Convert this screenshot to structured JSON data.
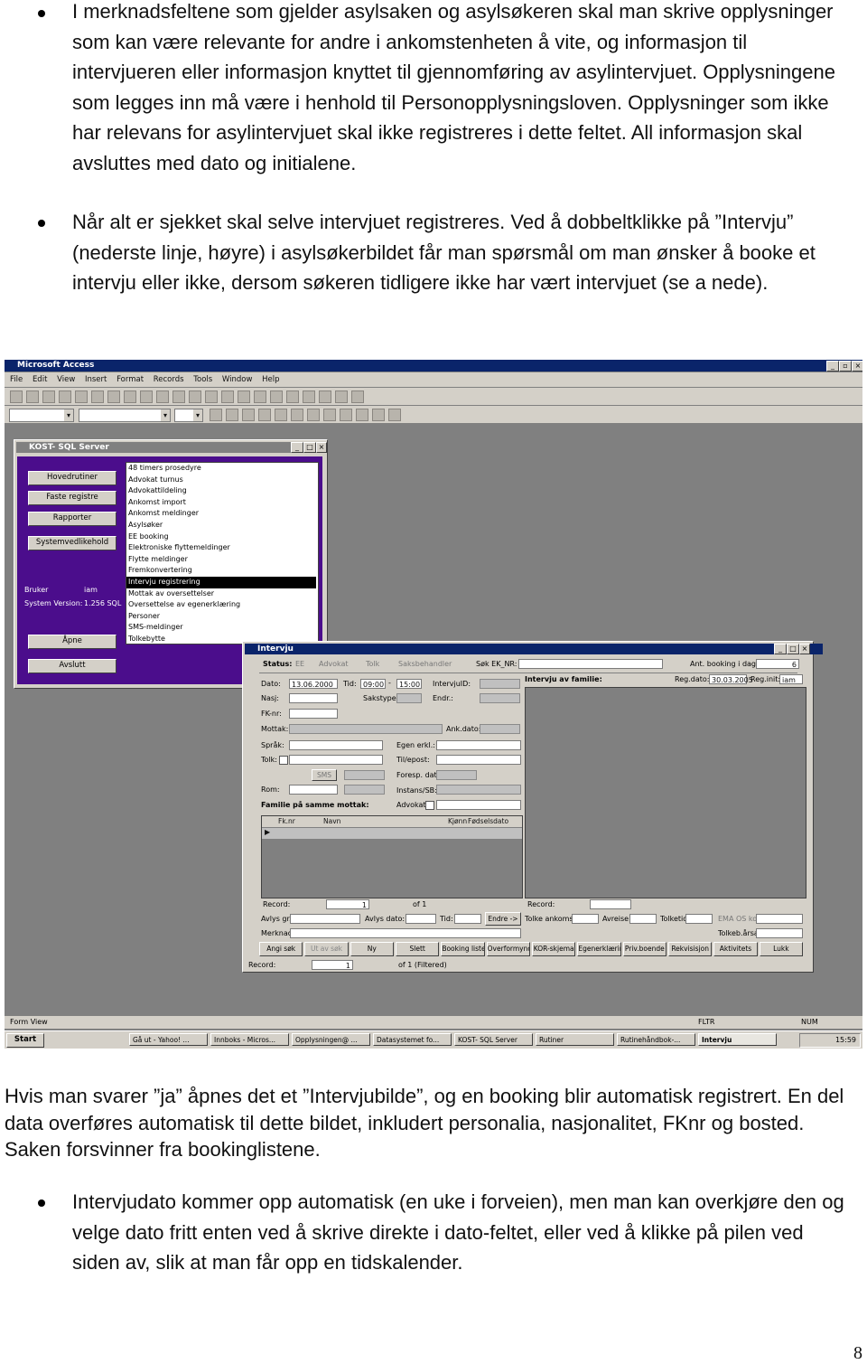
{
  "intro": {
    "bullet1": "I merknadsfeltene som gjelder asylsaken og asylsøkeren skal man skrive opplysninger som kan være relevante for andre i ankomstenheten å vite, og informasjon til intervjueren eller informasjon knyttet til gjennomføring av asylintervjuet. Opplysningene som legges inn må være i henhold til Personopplysningsloven. Opplysninger som ikke har relevans for asylintervjuet skal ikke registreres i dette feltet. All informasjon skal avsluttes med dato og initialene.",
    "bullet2": "Når alt er sjekket skal selve intervjuet registreres. Ved å dobbeltklikke på ”Intervju” (nederste linje, høyre) i asylsøkerbildet får man spørsmål om man ønsker å booke et intervju eller ikke, dersom søkeren tidligere ikke har vært intervjuet (se a nede)."
  },
  "screenshot": {
    "app_title": "Microsoft Access",
    "menu": [
      "File",
      "Edit",
      "View",
      "Insert",
      "Format",
      "Records",
      "Tools",
      "Window",
      "Help"
    ],
    "kost_title": "KOST- SQL Server",
    "kost_buttons": [
      "Hovedrutiner",
      "Faste registre",
      "Rapporter",
      "Systemvedlikehold"
    ],
    "bruker_label": "Bruker",
    "bruker_value": "iam",
    "version_label": "System Version:",
    "version_value": "1.256 SQL",
    "apne": "Åpne",
    "avslutt": "Avslutt",
    "list_items": [
      "48 timers prosedyre",
      "Advokat turnus",
      "Advokattildeling",
      "Ankomst import",
      "Ankomst meldinger",
      "Asylsøker",
      "EE booking",
      "Elektroniske flyttemeldinger",
      "Flytte meldinger",
      "Fremkonvertering",
      "Intervju registrering",
      "Mottak av oversettelser",
      "Oversettelse av egenerklæring",
      "Personer",
      "SMS-meldinger",
      "Tolkebytte"
    ],
    "intervju_title": "Intervju",
    "status_label": "Status:",
    "opt_ee": "EE",
    "opt_advokat": "Advokat",
    "opt_tolk": "Tolk",
    "opt_saksbehandler": "Saksbehandler",
    "sok_label": "Søk EK_NR:",
    "dato_label": "Dato:",
    "dato_value": "13.06.2000",
    "tid_label": "Tid:",
    "tid_value": "09:00",
    "tid_end": "15:00",
    "intervjuid_label": "IntervjuID:",
    "nasj_label": "Nasj:",
    "sakstype_label": "Sakstype:",
    "endr_label": "Endr.:",
    "fknr_label": "FK-nr:",
    "mottak_label": "Mottak:",
    "ank_label": "Ank.dato:",
    "sprak_label": "Språk:",
    "egen_label": "Egen erkl.:",
    "tolk_label": "Tolk:",
    "tilepost_label": "Til/epost:",
    "sms_label": "SMS",
    "foresp_label": "Foresp. dato",
    "rom_label": "Rom:",
    "instans_label": "Instans/SB:",
    "familie_label": "Familie på samme mottak:",
    "advokat_label": "Advokat:",
    "fam_headers": [
      "Fk.nr",
      "Navn",
      "Kjønn",
      "Fødselsdato"
    ],
    "record_label": "Record:",
    "record_value": "1",
    "of_label": "of 1",
    "avlys_label": "Avlys gr.:",
    "avlys_dato_label": "Avlys dato:",
    "tid2_label": "Tid:",
    "endre_label": "Endre ->",
    "merknad_label": "Merknad:",
    "intervju_av_familie": "Intervju av familie:",
    "ant_booking_label": "Ant. booking i dag:",
    "ant_booking_value": "6",
    "reg_dato_label": "Reg.dato:",
    "reg_dato_value": "30.03.2005",
    "reg_init_label": "Reg.init:",
    "reg_init_value": "iam",
    "record2_label": "Record:",
    "tolke_ankomst": "Tolke ankomst:",
    "avreise": "Avreise:",
    "tolkettid": "Tolketid:",
    "ema_label": "EMA OS kode",
    "tolkeb_label": "Tolkeb.årsak:",
    "bottom_buttons": [
      "Angi søk",
      "Ut av søk",
      "Ny",
      "Slett",
      "Booking liste",
      "Overformynd",
      "KOR-skjema",
      "Egenerklæring",
      "Priv.boende",
      "Rekvisisjon",
      "Aktivitets",
      "Lukk"
    ],
    "footer_record": "Record:",
    "footer_value": "1",
    "footer_of": "of 1 (Filtered)",
    "form_view": "Form View",
    "fltr": "FLTR",
    "num": "NUM",
    "start": "Start",
    "tasks": [
      "Gå ut - Yahoo! ...",
      "Innboks - Micros...",
      "Opplysningen@ ...",
      "Datasystemet fo...",
      "KOST- SQL Server",
      "Rutiner",
      "Rutinehåndbok-...",
      "Intervju"
    ],
    "clock": "15:59"
  },
  "after": {
    "para": "Hvis man svarer ”ja” åpnes det et ”Intervjubilde”, og en booking blir automatisk registrert. En del data overføres automatisk til dette bildet, inkludert personalia, nasjonalitet, FKnr og bosted. Saken forsvinner fra bookinglistene.",
    "bullet3": "Intervjudato kommer opp automatisk (en uke i forveien), men man kan overkjøre den og velge dato fritt enten ved å skrive direkte i dato-feltet, eller ved å klikke på pilen ved siden av, slik at man får opp en tidskalender."
  },
  "page_number": "8"
}
